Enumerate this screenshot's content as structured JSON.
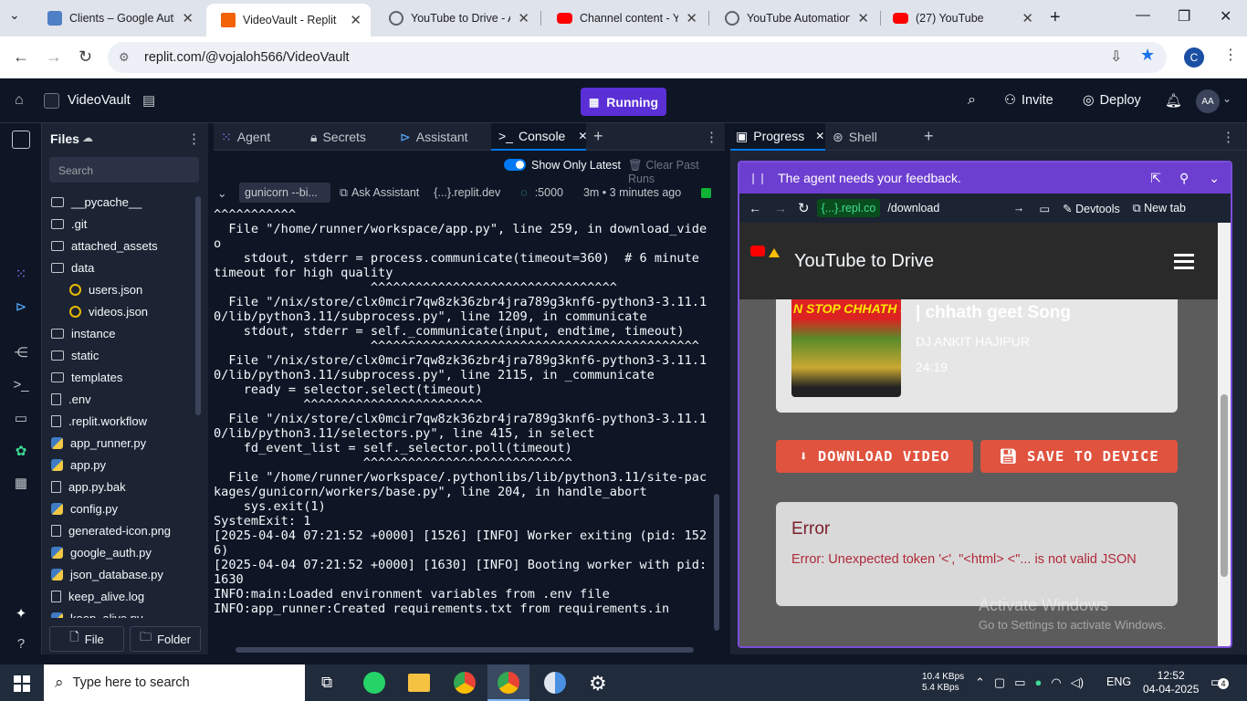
{
  "browser": {
    "tabs": [
      {
        "title": "Clients – Google Auth",
        "color": "#4f7fc4"
      },
      {
        "title": "VideoVault - Replit",
        "color": "#f26207"
      },
      {
        "title": "YouTube to Drive - Au",
        "color": "#5f6368"
      },
      {
        "title": "Channel content - Yo",
        "color": "#ff0000"
      },
      {
        "title": "YouTube Automation",
        "color": "#5f6368"
      },
      {
        "title": "(27) YouTube",
        "color": "#ff0000"
      }
    ],
    "url": "replit.com/@vojaloh566/VideoVault",
    "profile_initial": "C"
  },
  "replit": {
    "project_name": "VideoVault",
    "run_status": "Running",
    "invite": "Invite",
    "deploy": "Deploy",
    "avatar": "AA"
  },
  "files": {
    "title": "Files",
    "search_placeholder": "Search",
    "items": [
      {
        "name": "__pycache__",
        "type": "folder"
      },
      {
        "name": ".git",
        "type": "folder"
      },
      {
        "name": "attached_assets",
        "type": "folder"
      },
      {
        "name": "data",
        "type": "folder"
      },
      {
        "name": "users.json",
        "type": "json"
      },
      {
        "name": "videos.json",
        "type": "json"
      },
      {
        "name": "instance",
        "type": "folder"
      },
      {
        "name": "static",
        "type": "folder"
      },
      {
        "name": "templates",
        "type": "folder"
      },
      {
        "name": ".env",
        "type": "file"
      },
      {
        "name": ".replit.workflow",
        "type": "file"
      },
      {
        "name": "app_runner.py",
        "type": "py"
      },
      {
        "name": "app.py",
        "type": "py"
      },
      {
        "name": "app.py.bak",
        "type": "file"
      },
      {
        "name": "config.py",
        "type": "py"
      },
      {
        "name": "generated-icon.png",
        "type": "image"
      },
      {
        "name": "google_auth.py",
        "type": "py"
      },
      {
        "name": "json_database.py",
        "type": "py"
      },
      {
        "name": "keep_alive.log",
        "type": "file"
      },
      {
        "name": "keep_alive.py",
        "type": "py"
      }
    ],
    "new_file": "File",
    "new_folder": "Folder"
  },
  "console": {
    "tabs": [
      "Agent",
      "Secrets",
      "Assistant",
      "Console"
    ],
    "show_only_latest": "Show Only Latest",
    "clear_past_runs": "Clear Past Runs",
    "run_cmd": "gunicorn --bi...",
    "ask_assistant": "Ask Assistant",
    "domain": "{...}.replit.dev",
    "port": ":5000",
    "elapsed": "3m • 3 minutes ago",
    "log": "^^^^^^^^^^^\n  File \"/home/runner/workspace/app.py\", line 259, in download_video\n    stdout, stderr = process.communicate(timeout=360)  # 6 minute timeout for high quality\n                     ^^^^^^^^^^^^^^^^^^^^^^^^^^^^^^^^^\n  File \"/nix/store/clx0mcir7qw8zk36zbr4jra789g3knf6-python3-3.11.10/lib/python3.11/subprocess.py\", line 1209, in communicate\n    stdout, stderr = self._communicate(input, endtime, timeout)\n                     ^^^^^^^^^^^^^^^^^^^^^^^^^^^^^^^^^^^^^^^^^^^^\n  File \"/nix/store/clx0mcir7qw8zk36zbr4jra789g3knf6-python3-3.11.10/lib/python3.11/subprocess.py\", line 2115, in _communicate\n    ready = selector.select(timeout)\n            ^^^^^^^^^^^^^^^^^^^^^^^^\n  File \"/nix/store/clx0mcir7qw8zk36zbr4jra789g3knf6-python3-3.11.10/lib/python3.11/selectors.py\", line 415, in select\n    fd_event_list = self._selector.poll(timeout)\n                    ^^^^^^^^^^^^^^^^^^^^^^^^^^^^\n  File \"/home/runner/workspace/.pythonlibs/lib/python3.11/site-packages/gunicorn/workers/base.py\", line 204, in handle_abort\n    sys.exit(1)\nSystemExit: 1\n[2025-04-04 07:21:52 +0000] [1526] [INFO] Worker exiting (pid: 1526)\n[2025-04-04 07:21:52 +0000] [1630] [INFO] Booting worker with pid: 1630\nINFO:main:Loaded environment variables from .env file\nINFO:app_runner:Created requirements.txt from requirements.in"
  },
  "right": {
    "tabs": [
      "Progress",
      "Shell"
    ],
    "feedback_text": "The agent needs your feedback.",
    "host": "{...}.repl.co",
    "path": "/download",
    "devtools": "Devtools",
    "new_tab": "New tab"
  },
  "webapp": {
    "brand": "YouTube to Drive",
    "thumb_text": "N STOP CHHATH S",
    "video_title": "| chhath geet Song",
    "channel": "DJ ANKIT HAJIPUR",
    "duration": "24:19",
    "download_btn": "DOWNLOAD VIDEO",
    "save_btn": "SAVE TO DEVICE",
    "error_title": "Error",
    "error_msg": "Error: Unexpected token '<', \"<html> <\"... is not valid JSON",
    "watermark1": "Activate Windows",
    "watermark2": "Go to Settings to activate Windows."
  },
  "taskbar": {
    "search_placeholder": "Type here to search",
    "net_up": "10.4 KBps",
    "net_down": "5.4 KBps",
    "lang": "ENG",
    "time": "12:52",
    "date": "04-04-2025",
    "notif_count": "4"
  }
}
